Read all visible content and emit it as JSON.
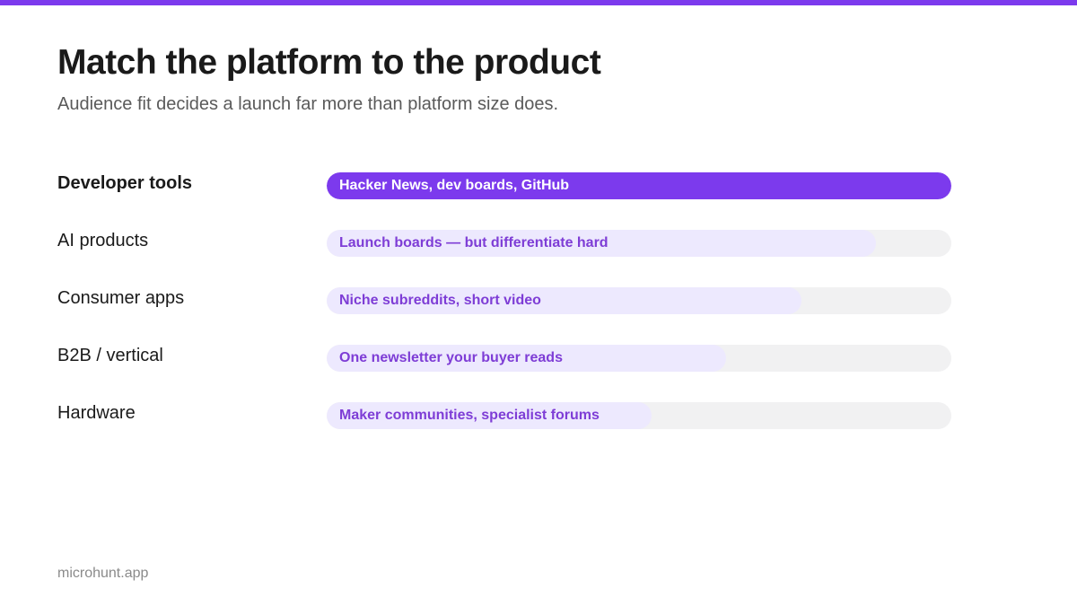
{
  "slide": {
    "title": "Match the platform to the product",
    "subtitle": "Audience fit decides a launch far more than platform size does.",
    "footer": "microhunt.app"
  },
  "colors": {
    "accent": "#7c3aed",
    "fill_light": "#ede9fe",
    "track": "#f1f1f2",
    "text_on_accent": "#ffffff",
    "text_on_light": "#7e3dd6"
  },
  "rows": [
    {
      "label": "Developer tools",
      "bar_text": "Hacker News, dev boards, GitHub",
      "fit": 1.0,
      "highlighted": true
    },
    {
      "label": "AI products",
      "bar_text": "Launch boards — but differentiate hard",
      "fit": 0.88,
      "highlighted": false
    },
    {
      "label": "Consumer apps",
      "bar_text": "Niche subreddits, short video",
      "fit": 0.76,
      "highlighted": false
    },
    {
      "label": "B2B / vertical",
      "bar_text": "One newsletter your buyer reads",
      "fit": 0.64,
      "highlighted": false
    },
    {
      "label": "Hardware",
      "bar_text": "Maker communities, specialist forums",
      "fit": 0.52,
      "highlighted": false
    }
  ]
}
